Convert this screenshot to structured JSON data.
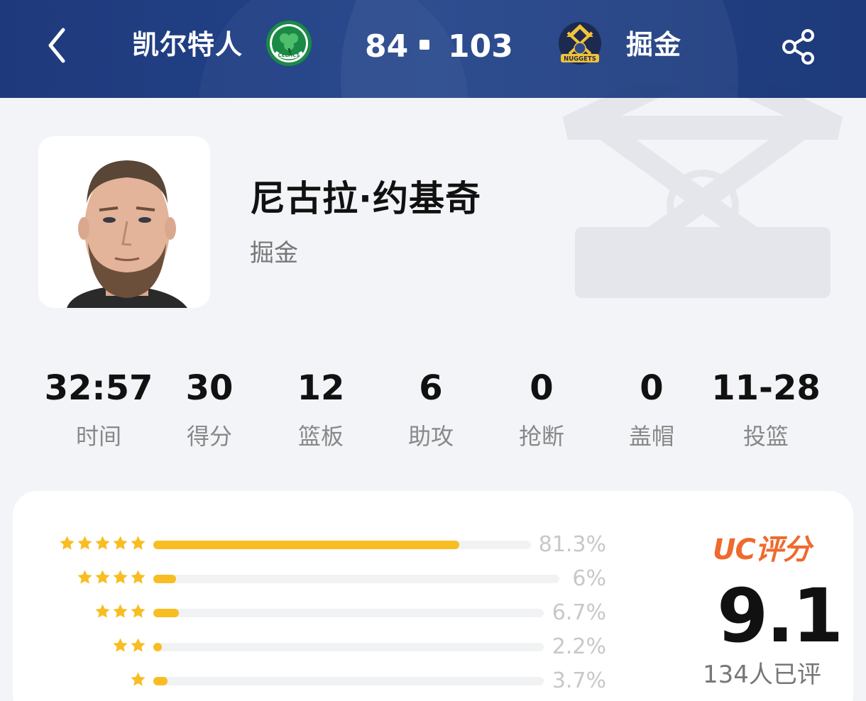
{
  "header": {
    "home_team": "凯尔特人",
    "home_score": "84",
    "away_score": "103",
    "away_team": "掘金",
    "home_logo_icon": "celtics-logo-icon",
    "away_logo_icon": "nuggets-logo-icon",
    "home_logo_text": "CELTICS",
    "away_logo_text": "NUGGETS"
  },
  "player": {
    "name": "尼古拉·约基奇",
    "team": "掘金"
  },
  "stats": [
    {
      "value": "32:57",
      "label": "时间"
    },
    {
      "value": "30",
      "label": "得分"
    },
    {
      "value": "12",
      "label": "篮板"
    },
    {
      "value": "6",
      "label": "助攻"
    },
    {
      "value": "0",
      "label": "抢断"
    },
    {
      "value": "0",
      "label": "盖帽"
    },
    {
      "value": "11-28",
      "label": "投篮"
    }
  ],
  "rating": {
    "rows": [
      {
        "stars": 5,
        "pct": "81.3%",
        "fraction": 0.813
      },
      {
        "stars": 4,
        "pct": "6%",
        "fraction": 0.06
      },
      {
        "stars": 3,
        "pct": "6.7%",
        "fraction": 0.067
      },
      {
        "stars": 2,
        "pct": "2.2%",
        "fraction": 0.022
      },
      {
        "stars": 1,
        "pct": "3.7%",
        "fraction": 0.037
      }
    ],
    "title": "UC评分",
    "score": "9.1",
    "count": "134人已评"
  },
  "colors": {
    "header": "#1f3a7c",
    "star": "#f8bd22",
    "uc_accent": "#ef6a2c",
    "celtics_green": "#1b8a46",
    "nuggets_gold": "#f2c23a"
  }
}
